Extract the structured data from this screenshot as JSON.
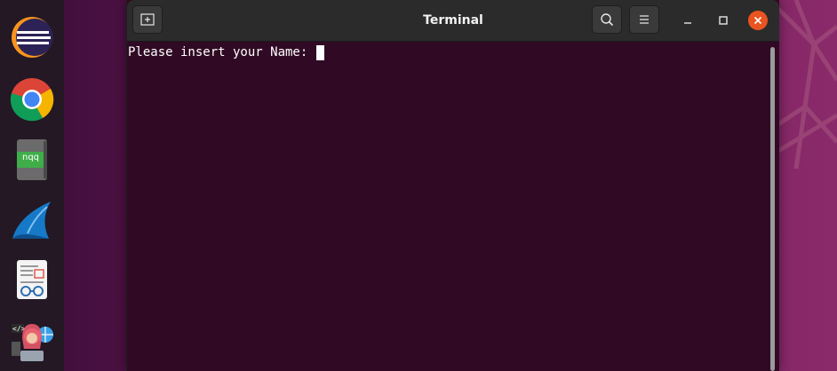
{
  "window": {
    "title": "Terminal",
    "new_tab_icon": "new-tab-icon",
    "search_icon": "search-icon",
    "menu_icon": "hamburger-menu-icon",
    "close_color": "#e95420"
  },
  "terminal": {
    "prompt_text": "Please insert your Name: ",
    "background": "#300a24",
    "text_color": "#ffffff"
  },
  "dock": {
    "items": [
      {
        "name": "eclipse",
        "icon": "eclipse-icon"
      },
      {
        "name": "chrome",
        "icon": "chrome-icon"
      },
      {
        "name": "nqq",
        "label": "nqq",
        "icon": "notepadqq-icon"
      },
      {
        "name": "wireshark",
        "icon": "wireshark-icon"
      },
      {
        "name": "document-viewer",
        "icon": "document-viewer-icon"
      },
      {
        "name": "developer-app",
        "icon": "developer-icon"
      }
    ]
  }
}
